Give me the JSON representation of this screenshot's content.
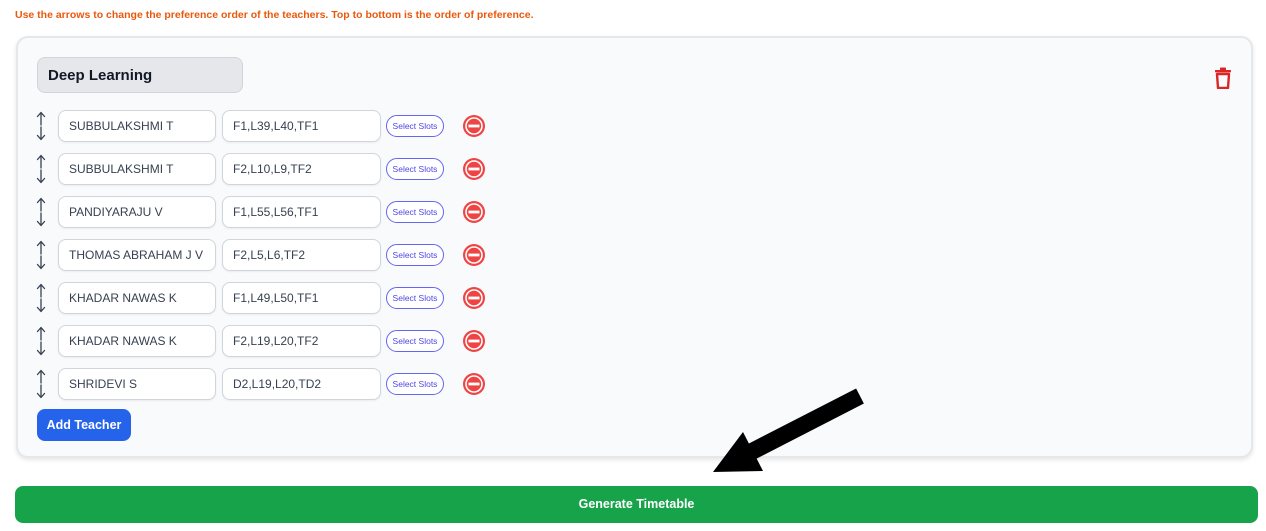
{
  "instruction": "Use the arrows to change the preference order of the teachers. Top to bottom is the order of preference.",
  "subject": {
    "name": "Deep Learning",
    "delete_icon": "trash-icon"
  },
  "teachers": [
    {
      "name": "SUBBULAKSHMI T",
      "slots": "F1,L39,L40,TF1",
      "select_label": "Select Slots"
    },
    {
      "name": "SUBBULAKSHMI T",
      "slots": "F2,L10,L9,TF2",
      "select_label": "Select Slots"
    },
    {
      "name": "PANDIYARAJU V",
      "slots": "F1,L55,L56,TF1",
      "select_label": "Select Slots"
    },
    {
      "name": "THOMAS ABRAHAM J V",
      "slots": "F2,L5,L6,TF2",
      "select_label": "Select Slots"
    },
    {
      "name": "KHADAR NAWAS K",
      "slots": "F1,L49,L50,TF1",
      "select_label": "Select Slots"
    },
    {
      "name": "KHADAR NAWAS K",
      "slots": "F2,L19,L20,TF2",
      "select_label": "Select Slots"
    },
    {
      "name": "SHRIDEVI S",
      "slots": "D2,L19,L20,TD2",
      "select_label": "Select Slots"
    }
  ],
  "add_teacher_label": "Add Teacher",
  "generate_label": "Generate Timetable",
  "colors": {
    "instruction": "#ea580c",
    "add_button": "#2563eb",
    "generate_button": "#16a34a",
    "remove_icon": "#ef4444",
    "select_slots_border": "#6366f1"
  }
}
